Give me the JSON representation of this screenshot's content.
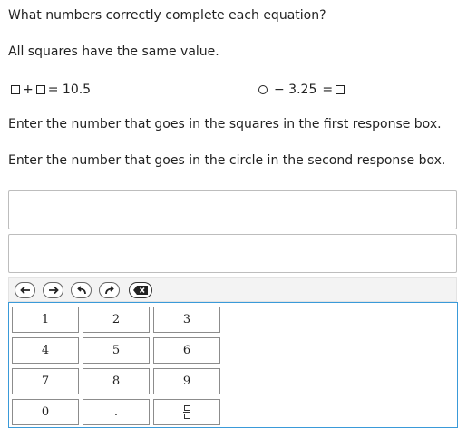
{
  "question": "What numbers correctly complete each equation?",
  "note": "All squares have the same value.",
  "eq1": {
    "plus": "+",
    "eq_result": "= 10.5"
  },
  "eq2": {
    "minus_val": "− 3.25",
    "equals": "="
  },
  "instruction1": "Enter the number that goes in the squares in the first response box.",
  "instruction2": "Enter the number that goes in the circle in the second response box.",
  "response_boxes": [
    "",
    ""
  ],
  "toolbar": [
    "left-arrow-icon",
    "right-arrow-icon",
    "undo-icon",
    "redo-icon",
    "backspace-icon"
  ],
  "keypad": {
    "keys": [
      "1",
      "2",
      "3",
      "4",
      "5",
      "6",
      "7",
      "8",
      "9",
      "0",
      "."
    ],
    "fraction_key": "fraction-icon"
  },
  "colors": {
    "keypad_border": "#3a9ad9",
    "toolbar_bg": "#f3f3f3"
  }
}
